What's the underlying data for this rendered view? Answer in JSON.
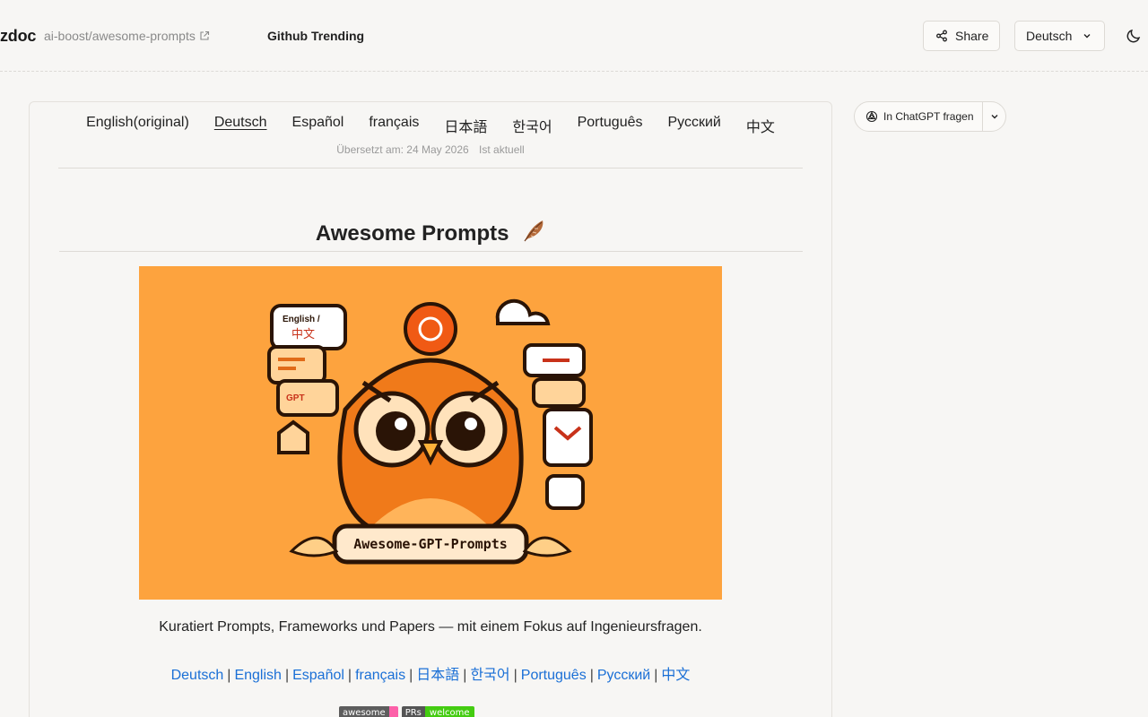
{
  "header": {
    "brand": "zdoc",
    "repo": "ai-boost/awesome-prompts",
    "nav": "Github Trending",
    "share_label": "Share",
    "language_label": "Deutsch",
    "icons": [
      "external-link-icon",
      "share-icon",
      "chevron-down-icon",
      "moon-icon"
    ]
  },
  "translation_bar": {
    "languages": [
      "English(original)",
      "Deutsch",
      "Español",
      "français",
      "日本語",
      "한국어",
      "Português",
      "Русский",
      "中文"
    ],
    "active": "Deutsch",
    "translated_on": "Übersetzt am: 24 May 2026",
    "status": "Ist aktuell"
  },
  "document": {
    "title": "Awesome Prompts",
    "title_icon": "feather-icon",
    "hero_text": "Awesome-GPT-Prompts",
    "hero_bubble_en": "English /",
    "hero_bubble_cn": "中文",
    "hero_gpt": "GPT",
    "description": "Kuratiert Prompts, Frameworks und Papers — mit einem Fokus auf Ingenieursfragen.",
    "links": [
      "Deutsch",
      "English",
      "Español",
      "français",
      "日本語",
      "한국어",
      "Português",
      "Русский",
      "中文"
    ],
    "badges": [
      {
        "left": "awesome",
        "right": "",
        "left_color": "#5d5d5d",
        "right_color": "#fc60a8"
      },
      {
        "left": "PRs",
        "right": "welcome",
        "left_color": "#555555",
        "right_color": "#4c1"
      }
    ]
  },
  "sidebar": {
    "ask_chatgpt": "In ChatGPT fragen",
    "icons": [
      "openai-icon",
      "chevron-down-icon"
    ]
  },
  "colors": {
    "background": "#f7f6f4",
    "link": "#1a6fd6",
    "hero_background": "#fda33e",
    "hero_owl": "#f07a1a"
  }
}
